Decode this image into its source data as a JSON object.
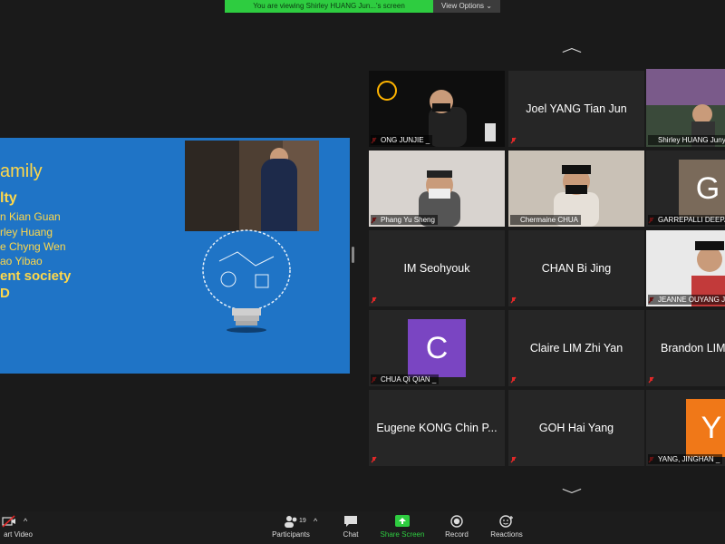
{
  "banner": {
    "message": "You are viewing Shirley HUANG Jun...'s screen",
    "view_options": "View Options ⌄"
  },
  "slide": {
    "lines": [
      "amily",
      "lty",
      "n Kian Guan",
      "rley Huang",
      "e Chyng Wen",
      "ao Yibao",
      "ent society",
      "D"
    ]
  },
  "gallery": {
    "tiles": [
      {
        "label": "ONG JUNJIE _"
      },
      {
        "name": "Joel YANG Tian Jun"
      },
      {
        "label": "Shirley HUANG Junyin"
      },
      {
        "label": "Phang Yu Sheng"
      },
      {
        "label": "Chermaine CHUA"
      },
      {
        "label": "GARREPALLI DEEPA",
        "letter": "G"
      },
      {
        "name": "IM Seohyouk"
      },
      {
        "name": "CHAN Bi Jing"
      },
      {
        "label": "JEANNE OUYANG JI"
      },
      {
        "label": "CHUA QI QIAN _",
        "letter": "C"
      },
      {
        "name": "Claire LIM Zhi Yan"
      },
      {
        "name": "Brandon LIM"
      },
      {
        "name": "Eugene KONG Chin P..."
      },
      {
        "name": "GOH Hai Yang"
      },
      {
        "label": "YANG, JINGHAN _",
        "letter": "Y"
      }
    ]
  },
  "toolbar": {
    "video": "art Video",
    "participants": "Participants",
    "participants_count": "19",
    "chat": "Chat",
    "share": "Share Screen",
    "record": "Record",
    "reactions": "Reactions"
  },
  "colors": {
    "share_green": "#2ecc40",
    "slide_blue": "#1f74c6",
    "slide_text": "#ffd84a",
    "active_border": "#e5d65a"
  }
}
